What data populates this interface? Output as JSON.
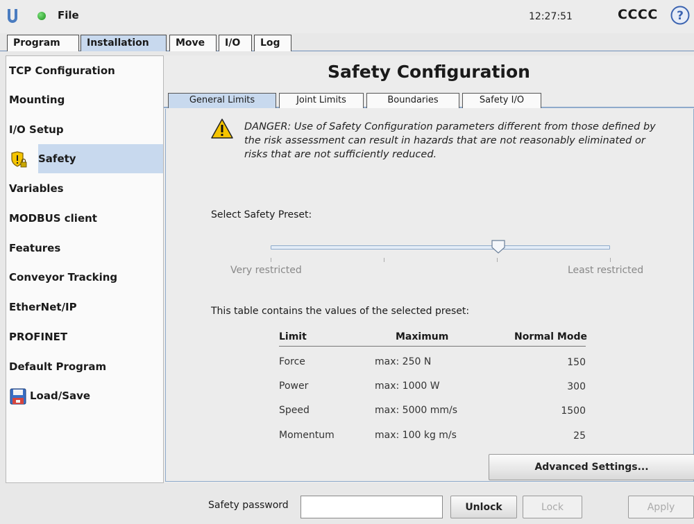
{
  "header": {
    "file_menu": "File",
    "clock": "12:27:51",
    "robot_name": "CCCC",
    "status_color": "#2ea82e"
  },
  "main_tabs": [
    {
      "label": "Program",
      "active": false
    },
    {
      "label": "Installation",
      "active": true
    },
    {
      "label": "Move",
      "active": false
    },
    {
      "label": "I/O",
      "active": false
    },
    {
      "label": "Log",
      "active": false
    }
  ],
  "sidebar": {
    "items": [
      {
        "label": "TCP Configuration"
      },
      {
        "label": "Mounting"
      },
      {
        "label": "I/O Setup"
      },
      {
        "label": "Safety",
        "icon": "shield-lock-icon",
        "active": true
      },
      {
        "label": "Variables"
      },
      {
        "label": "MODBUS client"
      },
      {
        "label": "Features"
      },
      {
        "label": "Conveyor Tracking"
      },
      {
        "label": "EtherNet/IP"
      },
      {
        "label": "PROFINET"
      },
      {
        "label": "Default Program"
      },
      {
        "label": "Load/Save",
        "icon": "floppy-disk-icon"
      }
    ]
  },
  "panel": {
    "title": "Safety Configuration",
    "sub_tabs": [
      {
        "label": "General Limits",
        "active": true
      },
      {
        "label": "Joint Limits",
        "active": false
      },
      {
        "label": "Boundaries",
        "active": false
      },
      {
        "label": "Safety I/O",
        "active": false
      }
    ],
    "danger_text": "DANGER: Use of Safety Configuration parameters different from those defined by the risk assessment can result in hazards that are not reasonably eliminated or risks that are not sufficiently reduced.",
    "preset_label": "Select Safety Preset:",
    "slider": {
      "min_label": "Very restricted",
      "max_label": "Least restricted",
      "position": 0.67
    },
    "table_intro": "This table contains the values of the selected preset:",
    "table": {
      "headers": [
        "Limit",
        "Maximum",
        "Normal Mode"
      ],
      "rows": [
        [
          "Force",
          "max: 250 N",
          "150"
        ],
        [
          "Power",
          "max: 1000 W",
          "300"
        ],
        [
          "Speed",
          "max: 5000 mm/s",
          "1500"
        ],
        [
          "Momentum",
          "max: 100 kg m/s",
          "25"
        ]
      ]
    },
    "advanced_button": "Advanced Settings..."
  },
  "footer": {
    "password_label": "Safety password",
    "password_value": "",
    "unlock_label": "Unlock",
    "lock_label": "Lock",
    "apply_label": "Apply"
  },
  "colors": {
    "active_tab": "#c8d9ee",
    "accent": "#6e8fb8",
    "warning": "#f5c400"
  }
}
